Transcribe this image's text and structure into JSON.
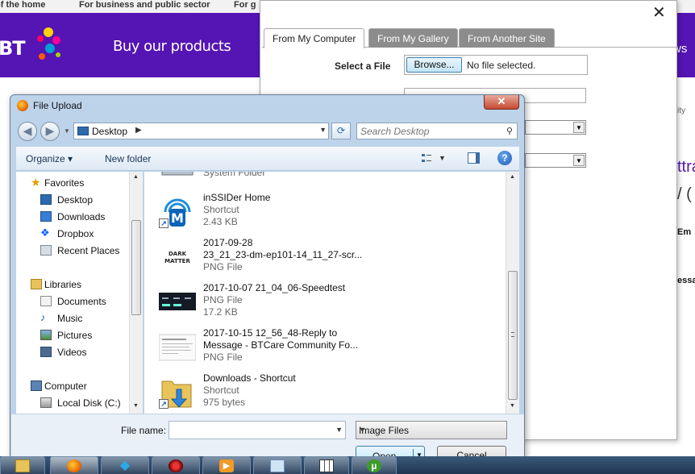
{
  "site": {
    "top_links": [
      "of the home",
      "For business and public sector",
      "For g"
    ],
    "logo_text": "BT",
    "buy_link": "Buy our products",
    "header_right": "ws",
    "right_strip": [
      "ity",
      "ttra",
      "/ (",
      "Em",
      "essa"
    ]
  },
  "modal": {
    "close": "✕",
    "tabs": [
      {
        "label": "From My Computer",
        "active": true
      },
      {
        "label": "From My Gallery",
        "active": false
      },
      {
        "label": "From Another Site",
        "active": false
      }
    ],
    "select_file_label": "Select a File",
    "browse_label": "Browse...",
    "no_file_text": "No file selected."
  },
  "dialog": {
    "title": "File Upload",
    "close_glyph": "✕",
    "address": "Desktop",
    "search_placeholder": "Search Desktop",
    "toolbar": {
      "organize": "Organize",
      "new_folder": "New folder"
    },
    "nav": {
      "favorites_header": "Favorites",
      "favorites": [
        "Desktop",
        "Downloads",
        "Dropbox",
        "Recent Places"
      ],
      "libraries_header": "Libraries",
      "libraries": [
        "Documents",
        "Music",
        "Pictures",
        "Videos"
      ],
      "computer_header": "Computer",
      "computer": [
        "Local Disk (C:)"
      ]
    },
    "files": [
      {
        "line1": "System Folder",
        "line2": "",
        "line3": "",
        "icon": "computer-icon"
      },
      {
        "line1": "inSSIDer Home",
        "line2": "Shortcut",
        "line3": "2.43 KB",
        "icon": "inssider-icon"
      },
      {
        "line1": "2017-09-28",
        "line2": "23_21_23-dm-ep101-14_11_27-scr...",
        "line3": "PNG File",
        "icon": "darkmatter-thumbnail"
      },
      {
        "line1": "2017-10-07 21_04_06-Speedtest",
        "line2": "PNG File",
        "line3": "17.2 KB",
        "icon": "speedtest-thumbnail"
      },
      {
        "line1": "2017-10-15 12_56_48-Reply to",
        "line2": "Message - BTCare Community Fo...",
        "line3": "PNG File",
        "icon": "document-thumbnail"
      },
      {
        "line1": "Downloads - Shortcut",
        "line2": "Shortcut",
        "line3": "975 bytes",
        "icon": "folder-shortcut-icon"
      }
    ],
    "filename_label": "File name:",
    "filename_value": "",
    "filetype": "Image Files",
    "open": "Open",
    "cancel": "Cancel"
  },
  "taskbar": {
    "items": [
      "explorer",
      "firefox",
      "kodi",
      "app-red",
      "media-player",
      "notepad",
      "grid-app",
      "utorrent"
    ]
  },
  "colors": {
    "bt_purple": "#5514b4",
    "dialog_frame": "#bcd3ea",
    "inactive_tab": "#8c8c8c"
  }
}
